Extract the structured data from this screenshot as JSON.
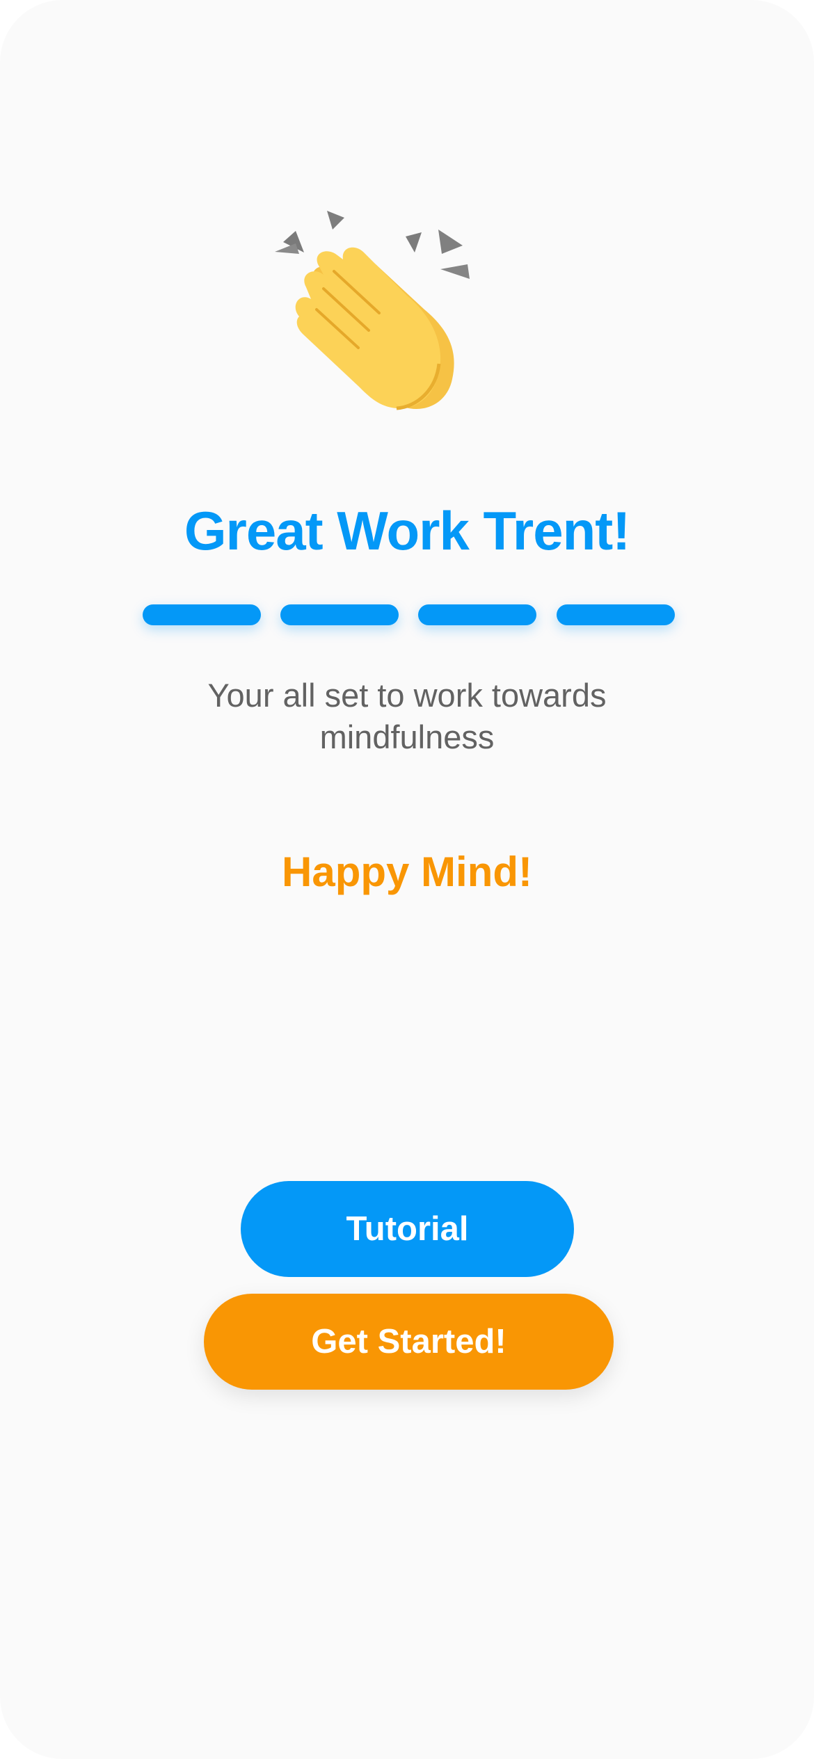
{
  "hero": {
    "icon": "clapping-hands-icon",
    "title": "Great Work Trent!",
    "subtitle": "Your all set to work towards mindfulness",
    "tagline": "Happy Mind!"
  },
  "progress": {
    "completed_steps": 4,
    "total_steps": 4
  },
  "actions": {
    "tutorial_label": "Tutorial",
    "get_started_label": "Get Started!"
  },
  "colors": {
    "background": "#fafafa",
    "primary_blue": "#0498f7",
    "accent_orange": "#f99604",
    "subtitle_gray": "#626262",
    "button_text": "#ffffff"
  }
}
